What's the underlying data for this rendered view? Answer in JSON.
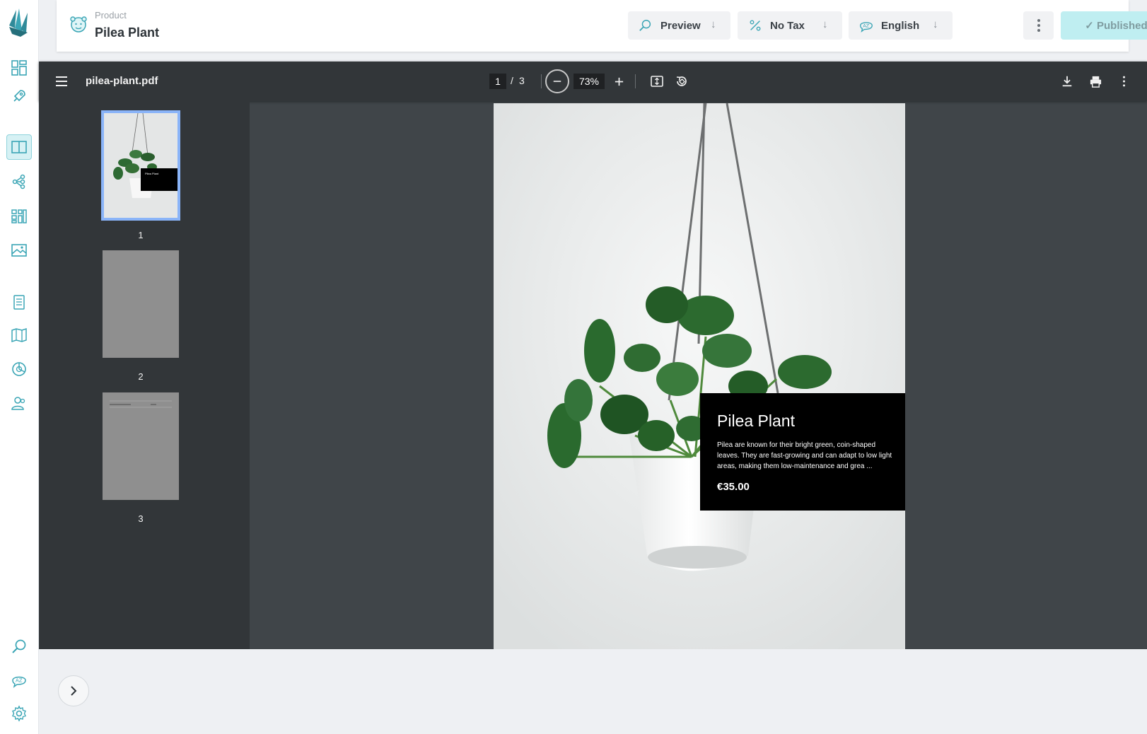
{
  "header": {
    "label": "Product",
    "title": "Pilea Plant",
    "preview_label": "Preview",
    "tax_label": "No Tax",
    "language_label": "English",
    "published_label": "✓ Published"
  },
  "viewer": {
    "filename": "pilea-plant.pdf",
    "current_page": "1",
    "separator": "/",
    "total_pages": "3",
    "zoom": "73%",
    "thumbnails": [
      {
        "number": "1"
      },
      {
        "number": "2"
      },
      {
        "number": "3"
      }
    ],
    "thumb_card_title": "Pilea Plant",
    "page_card": {
      "title": "Pilea Plant",
      "description": "Pilea are known for their bright green, coin-shaped leaves. They are fast-growing and can adapt to low light areas, making them low-maintenance and grea ...",
      "price": "€35.00"
    }
  },
  "colors": {
    "accent": "#3aa5b5",
    "published_bg": "#bfeef1",
    "viewer_toolbar": "#323639",
    "viewer_bg": "#404549",
    "thumb_selected": "#8ab4f8"
  },
  "icons": {
    "sidebar": [
      "logo-icon",
      "dashboard-icon",
      "rocket-icon",
      "book-icon",
      "share-nodes-icon",
      "grid-icon",
      "image-icon",
      "clipboard-icon",
      "map-icon",
      "chart-icon",
      "users-icon",
      "search-icon",
      "translate-icon",
      "gear-icon"
    ]
  }
}
